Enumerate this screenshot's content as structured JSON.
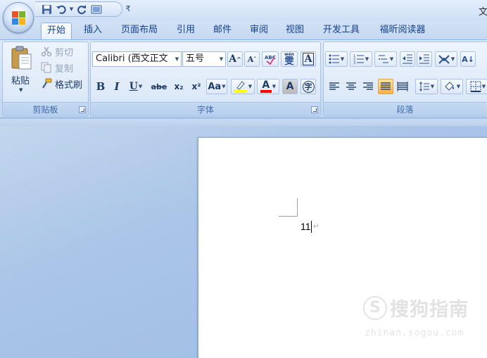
{
  "window": {
    "title": "文"
  },
  "tabs": [
    {
      "label": "开始",
      "active": true
    },
    {
      "label": "插入"
    },
    {
      "label": "页面布局"
    },
    {
      "label": "引用"
    },
    {
      "label": "邮件"
    },
    {
      "label": "审阅"
    },
    {
      "label": "视图"
    },
    {
      "label": "开发工具"
    },
    {
      "label": "福昕阅读器"
    }
  ],
  "clipboard": {
    "group_label": "剪贴板",
    "paste": "粘贴",
    "cut": "剪切",
    "copy": "复制",
    "format_painter": "格式刷"
  },
  "font": {
    "group_label": "字体",
    "font_name": "Calibri (西文正文",
    "font_size": "五号",
    "bold": "B",
    "italic": "I",
    "underline": "U",
    "strikethrough": "abe",
    "subscript": "x₂",
    "superscript": "x²",
    "change_case": "Aa",
    "font_color_letter": "A",
    "char_shading_letter": "A",
    "grow_font_letter": "A",
    "shrink_font_letter": "A",
    "char_border_letter": "A",
    "enclose_char": "字",
    "pinyin_top": "wén",
    "pinyin_char": "雯",
    "clear_format": "ABC"
  },
  "paragraph": {
    "group_label": "段落",
    "sort_icon_text": "A↓"
  },
  "document": {
    "text": "11",
    "para_mark": "↵"
  },
  "watermark": {
    "text": "搜狗指南",
    "logo": "S",
    "url": "zhinan.sogou.com"
  },
  "colors": {
    "highlight": "#ffff00",
    "font_color": "#ff0000",
    "accent": "#15428b"
  }
}
